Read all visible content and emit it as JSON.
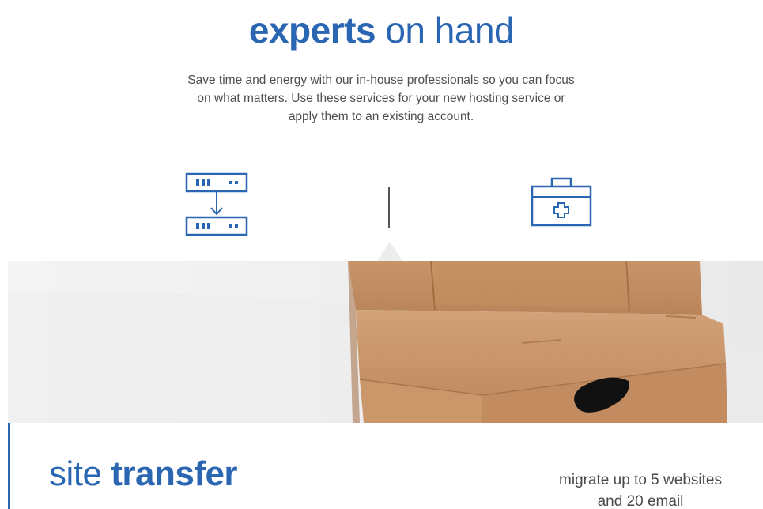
{
  "header": {
    "title_bold": "experts",
    "title_light": "on hand",
    "intro": "Save time and energy with our in-house professionals so you can focus on what matters. Use these services for your new hosting service or apply them to an existing account."
  },
  "services": {
    "items": [
      {
        "icon": "server-transfer-icon"
      },
      {
        "icon": "medical-kit-icon"
      }
    ],
    "selected_index": 0
  },
  "site_transfer": {
    "title_light": "site",
    "title_bold": "transfer",
    "description": "migrate up to 5 websites and 20 email"
  },
  "colors": {
    "brand_blue": "#2b66b3",
    "body_text": "#4f4f4f"
  }
}
